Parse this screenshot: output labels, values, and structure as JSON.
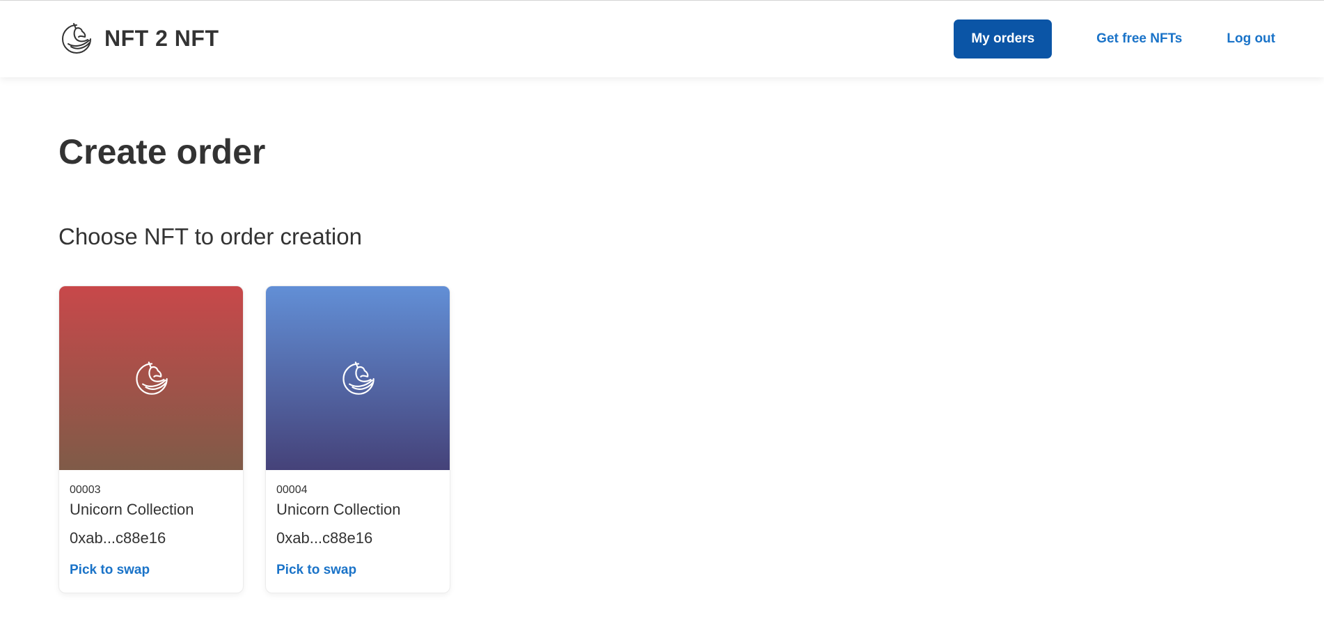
{
  "header": {
    "brand_name": "NFT 2 NFT",
    "logo_icon": "unicorn-logo-icon",
    "nav": {
      "my_orders": "My orders",
      "get_free_nfts": "Get free NFTs",
      "log_out": "Log out"
    }
  },
  "main": {
    "title": "Create order",
    "subtitle": "Choose NFT to order creation",
    "cards": [
      {
        "id": "00003",
        "collection": "Unicorn Collection",
        "address": "0xab...c88e16",
        "action": "Pick to swap",
        "icon": "unicorn-icon",
        "gradient": [
          "#c8484a",
          "#7f5b48"
        ]
      },
      {
        "id": "00004",
        "collection": "Unicorn Collection",
        "address": "0xab...c88e16",
        "action": "Pick to swap",
        "icon": "unicorn-icon",
        "gradient": [
          "#628fd6",
          "#454279"
        ]
      }
    ]
  },
  "colors": {
    "primary": "#0b55a6",
    "link": "#1a73c8",
    "text": "#333333"
  }
}
